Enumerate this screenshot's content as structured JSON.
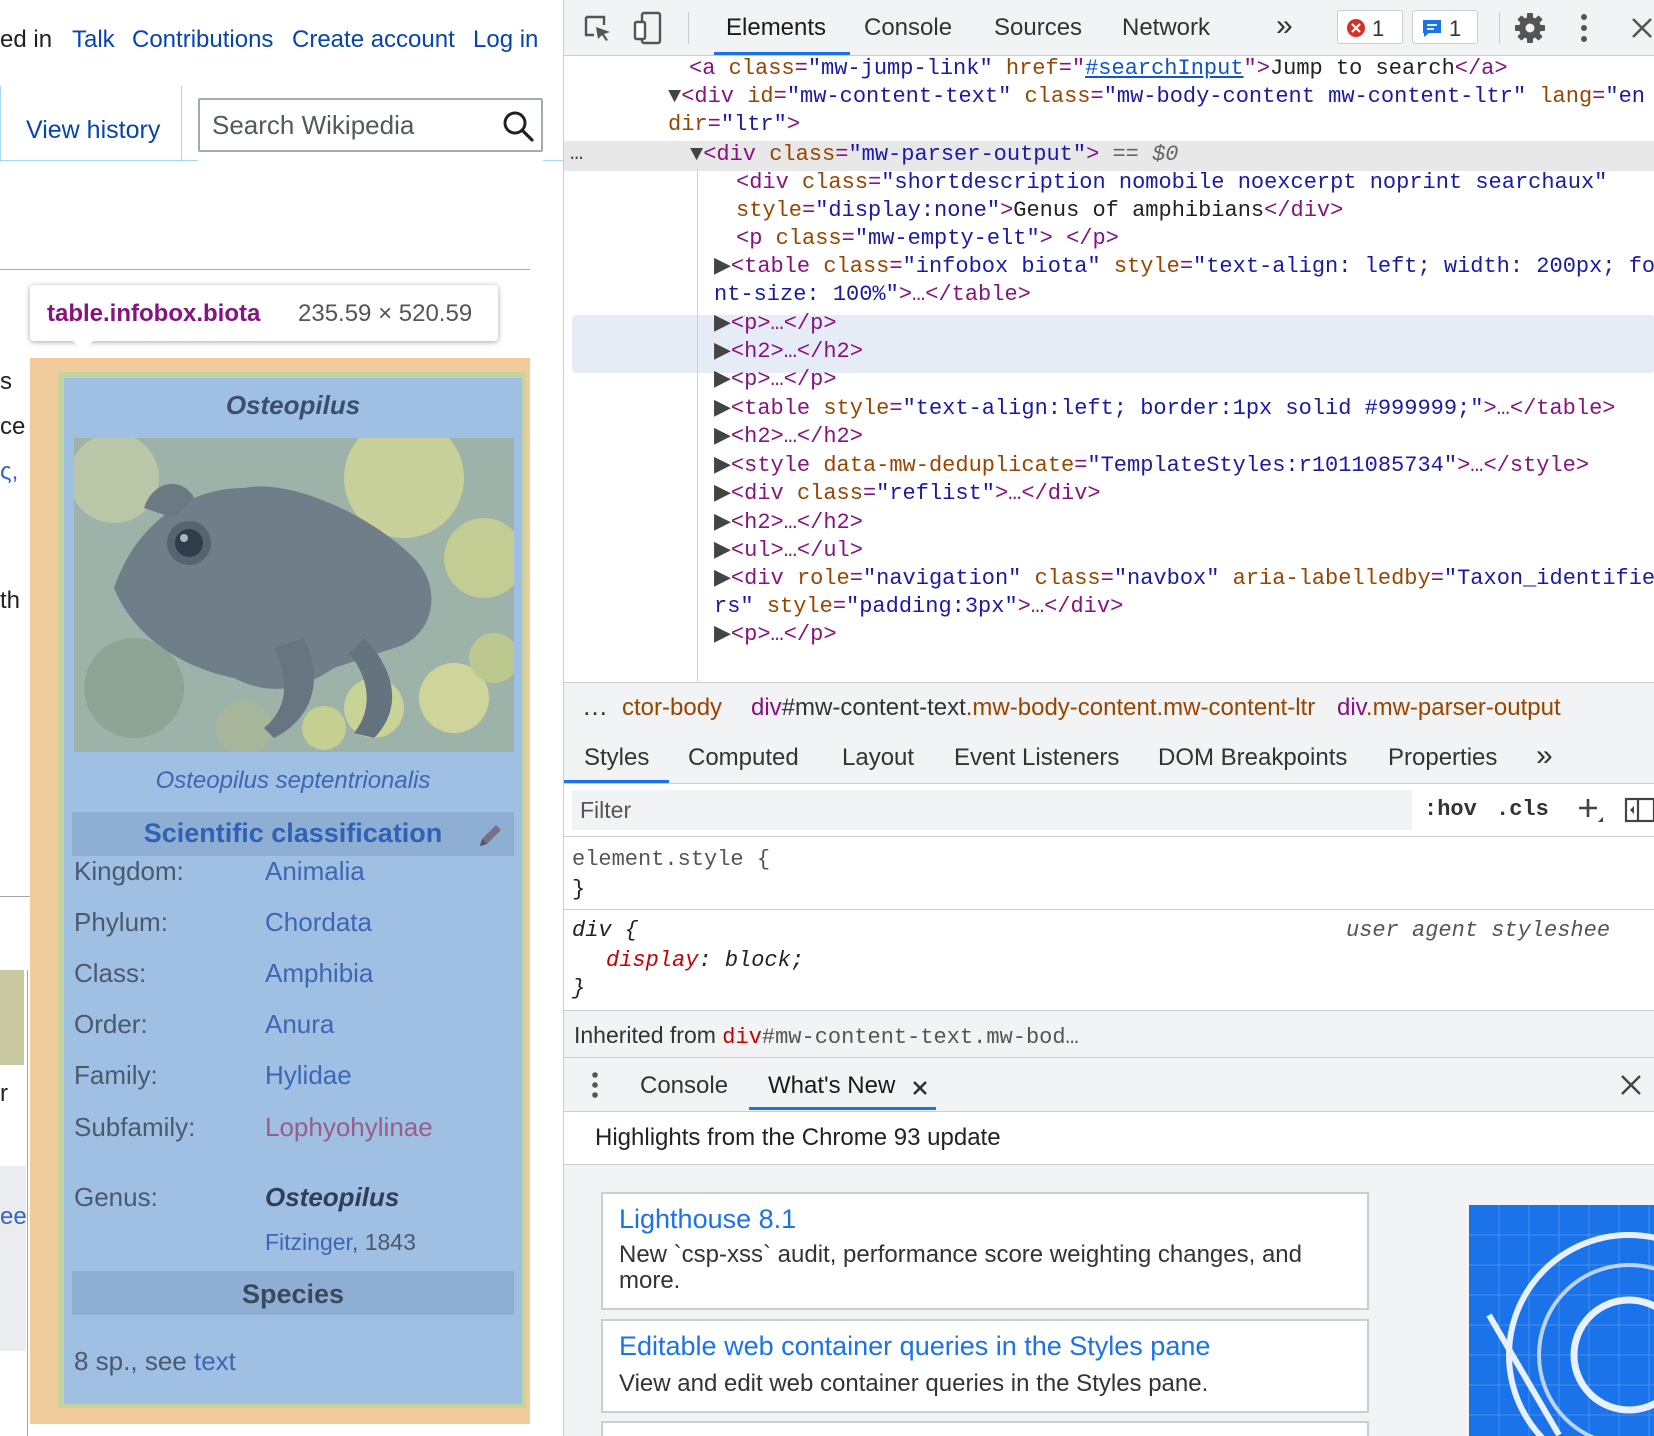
{
  "wiki": {
    "top_links": {
      "not_logged_in_fragment": "ed in",
      "talk": "Talk",
      "contributions": "Contributions",
      "create_account": "Create account",
      "log_in": "Log in"
    },
    "view_history": "View history",
    "search_placeholder": "Search Wikipedia",
    "edge_chars": [
      "s",
      "ce",
      "ς,",
      "th",
      "r",
      "ee"
    ],
    "tooltip": {
      "selector": "table.infobox.biota",
      "size": "235.59 × 520.59"
    },
    "infobox": {
      "title": "Osteopilus",
      "image_caption": "Osteopilus septentrionalis",
      "scientific_classification": "Scientific classification",
      "taxonomy": [
        {
          "label": "Kingdom:",
          "value": "Animalia"
        },
        {
          "label": "Phylum:",
          "value": "Chordata"
        },
        {
          "label": "Class:",
          "value": "Amphibia"
        },
        {
          "label": "Order:",
          "value": "Anura"
        },
        {
          "label": "Family:",
          "value": "Hylidae"
        },
        {
          "label": "Subfamily:",
          "value": "Lophyohylinae"
        },
        {
          "label": "Genus:",
          "value": "Osteopilus"
        }
      ],
      "authority_link": "Fitzinger",
      "authority_year": ", 1843",
      "species_header": "Species",
      "species_text": "8 sp., see ",
      "species_link": "text"
    }
  },
  "devtools": {
    "tabs": [
      "Elements",
      "Console",
      "Sources",
      "Network"
    ],
    "more_tabs": "»",
    "error_count": "1",
    "message_count": "1",
    "dom": {
      "l1_tag_open": "<a ",
      "l1_attr1": "class",
      "l1_val1": "\"mw-jump-link\"",
      "l1_attr2": "href",
      "l1_val2": "#searchInput",
      "l1_text": "Jump to search",
      "l1_close": "</a>",
      "l2_attr1": "id",
      "l2_val1": "\"mw-content-text\"",
      "l2_attr2": "class",
      "l2_val2": "\"mw-body-content mw-content-ltr\"",
      "l2_attr3": "lang",
      "l2_val3": "\"en",
      "l3_attr": "dir",
      "l3_val": "\"ltr\"",
      "l4_attr": "class",
      "l4_val": "\"mw-parser-output\"",
      "l4_eq": " == $0",
      "l5_attr": "class",
      "l5_val": "\"shortdescription nomobile noexcerpt noprint searchaux\"",
      "l6_attr": "style",
      "l6_val": "\"display:none\"",
      "l6_text": "Genus of amphibians",
      "l7_attr": "class",
      "l7_val": "\"mw-empty-elt\"",
      "l8_attr1": "class",
      "l8_val1": "\"infobox biota\"",
      "l8_attr2": "style",
      "l8_val2": "\"text-align: left; width: 200px; fo",
      "l9_val": "nt-size: 100%\"",
      "l13_attr": "style",
      "l13_val": "\"text-align:left; border:1px solid #999999;\"",
      "l15_attr": "data-mw-deduplicate",
      "l15_val": "\"TemplateStyles:r1011085734\"",
      "l16_attr": "class",
      "l16_val": "\"reflist\"",
      "l19_attr1": "role",
      "l19_val1": "\"navigation\"",
      "l19_attr2": "class",
      "l19_val2": "\"navbox\"",
      "l19_attr3": "aria-labelledby",
      "l19_val3": "\"Taxon_identifie",
      "l20_val": "rs\"",
      "l20_attr": "style",
      "l20_val2": "\"padding:3px\""
    },
    "breadcrumbs": {
      "c1": "ctor-body",
      "c2_tag": "div",
      "c2_rest": "#mw-content-text",
      "c2_class": ".mw-body-content.mw-content-ltr",
      "c3_tag": "div",
      "c3_class": ".mw-parser-output"
    },
    "styles_tabs": [
      "Styles",
      "Computed",
      "Layout",
      "Event Listeners",
      "DOM Breakpoints",
      "Properties"
    ],
    "filter_placeholder": "Filter",
    "hov": ":hov",
    "cls": ".cls",
    "rules": {
      "element_style": "element.style {",
      "close": "}",
      "div_selector": "div {",
      "user_agent": "user agent styleshee",
      "prop": "display",
      "value": "block;"
    },
    "inherited": {
      "label": "Inherited from ",
      "tag": "div",
      "rest": "#mw-content-text.mw-bod…"
    },
    "drawer_tabs": [
      "Console",
      "What's New"
    ],
    "highlights": "Highlights from the Chrome 93 update",
    "cards": [
      {
        "title": "Lighthouse 8.1",
        "desc": "New `csp-xss` audit, performance score weighting changes, and more."
      },
      {
        "title": "Editable web container queries in the Styles pane",
        "desc": "View and edit web container queries in the Styles pane."
      }
    ],
    "colors": {
      "accent": "#1a73e8",
      "tag": "#881280",
      "attr": "#994500",
      "value": "#1a1aa6"
    }
  }
}
